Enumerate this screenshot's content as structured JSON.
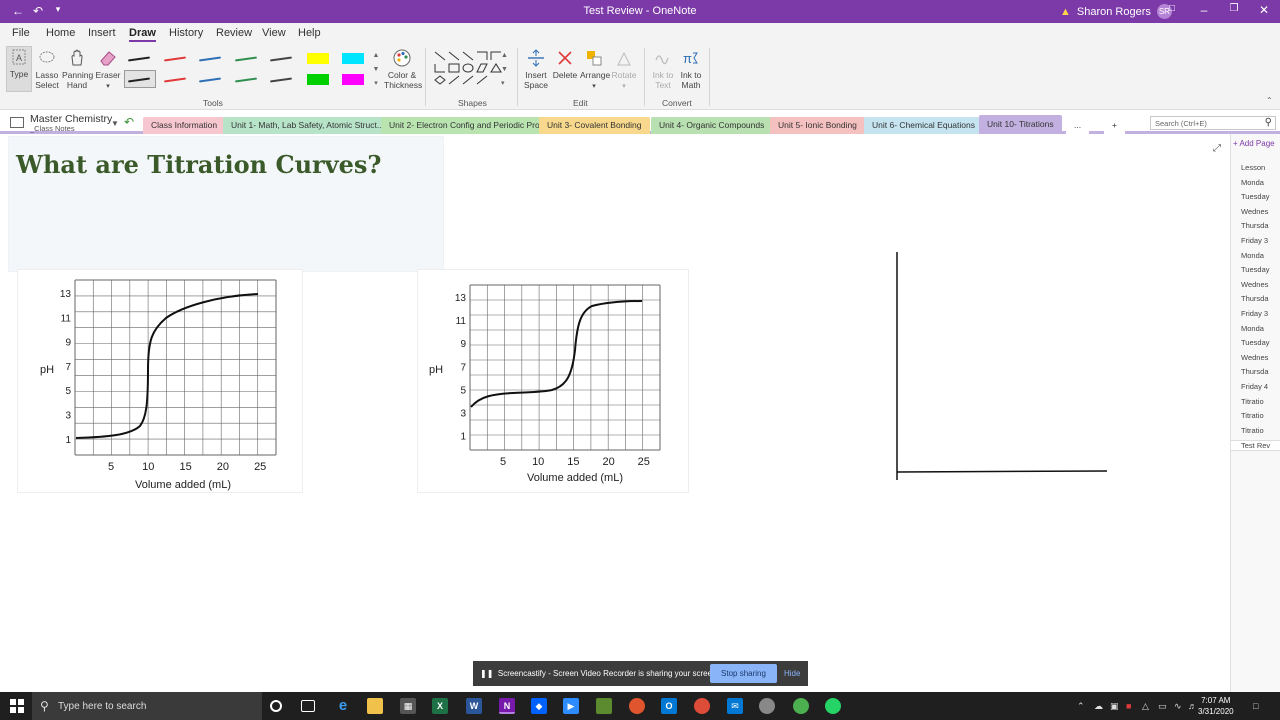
{
  "window": {
    "title": "Test Review  -  OneNote",
    "user_name": "Sharon Rogers",
    "user_initials": "SR"
  },
  "menu": {
    "tabs": [
      "File",
      "Home",
      "Insert",
      "Draw",
      "History",
      "Review",
      "View",
      "Help"
    ],
    "active": "Draw"
  },
  "ribbon": {
    "tools": {
      "type": "Type",
      "lasso": "Lasso Select",
      "lasso_1": "Lasso",
      "lasso_2": "Select",
      "panning_1": "Panning",
      "panning_2": "Hand",
      "eraser": "Eraser",
      "color_1": "Color &",
      "color_2": "Thickness",
      "group": "Tools"
    },
    "shapes": {
      "group": "Shapes"
    },
    "edit": {
      "insert_1": "Insert",
      "insert_2": "Space",
      "delete": "Delete",
      "arrange": "Arrange",
      "rotate": "Rotate",
      "group": "Edit"
    },
    "convert": {
      "ink_text_1": "Ink to",
      "ink_text_2": "Text",
      "ink_math_1": "Ink to",
      "ink_math_2": "Math",
      "group": "Convert"
    },
    "pen_colors": [
      "#222222",
      "#e03a3a",
      "#2f6fb5",
      "#2f8f4f",
      "#444444",
      "#ffff00",
      "#00e5ff",
      "#222222",
      "#e03a3a",
      "#2f6fb5",
      "#2f8f4f",
      "#444444",
      "#00d000",
      "#ff00ff"
    ]
  },
  "notebook": {
    "name": "Master Chemistry",
    "sub": "_Class Notes"
  },
  "sections": [
    {
      "label": "Class Information",
      "color": "#f7c7cf"
    },
    {
      "label": "Unit 1- Math, Lab Safety, Atomic Struct...",
      "color": "#b7e3c8"
    },
    {
      "label": "Unit 2- Electron Config and Periodic Pro...",
      "color": "#b9e4b0"
    },
    {
      "label": "Unit 3- Covalent Bonding",
      "color": "#f7d88c"
    },
    {
      "label": "Unit 4- Organic Compounds",
      "color": "#b8e0b0"
    },
    {
      "label": "Unit 5- Ionic Bonding",
      "color": "#f5c0c0"
    },
    {
      "label": "Unit 6- Chemical Equations",
      "color": "#c5e4f0"
    },
    {
      "label": "Unit 10- Titrations",
      "color": "#c2b1e0"
    },
    {
      "label": "...",
      "color": "#ffffff"
    },
    {
      "label": "+",
      "color": "#ffffff"
    }
  ],
  "search": {
    "placeholder": "Search (Ctrl+E)"
  },
  "page": {
    "title": "What are Titration Curves?"
  },
  "graph1": {
    "ylabel": "pH",
    "xlabel": "Volume added (mL)",
    "yticks": [
      "13",
      "11",
      "9",
      "7",
      "5",
      "3",
      "1"
    ],
    "xticks": [
      "5",
      "10",
      "15",
      "20",
      "25"
    ]
  },
  "graph2": {
    "ylabel": "pH",
    "xlabel": "Volume added (mL)",
    "yticks": [
      "13",
      "11",
      "9",
      "7",
      "5",
      "3",
      "1"
    ],
    "xticks": [
      "5",
      "10",
      "15",
      "20",
      "25"
    ]
  },
  "pages_pane": {
    "add_page": "+ Add Page",
    "items": [
      "Lesson",
      "Monda",
      "Tuesday",
      "Wednes",
      "Thursda",
      "Friday 3",
      "Monda",
      "Tuesday",
      "Wednes",
      "Thursda",
      "Friday 3",
      "Monda",
      "Tuesday",
      "Wednes",
      "Thursda",
      "Friday 4",
      "Titratio",
      "Titratio",
      "Titratio",
      "Test Rev"
    ],
    "selected_index": 19
  },
  "banner": {
    "text": "Screencastify - Screen Video Recorder is sharing your screen.",
    "stop": "Stop sharing",
    "hide": "Hide"
  },
  "taskbar": {
    "search_placeholder": "Type here to search",
    "time": "7:07 AM",
    "date": "3/31/2020"
  }
}
